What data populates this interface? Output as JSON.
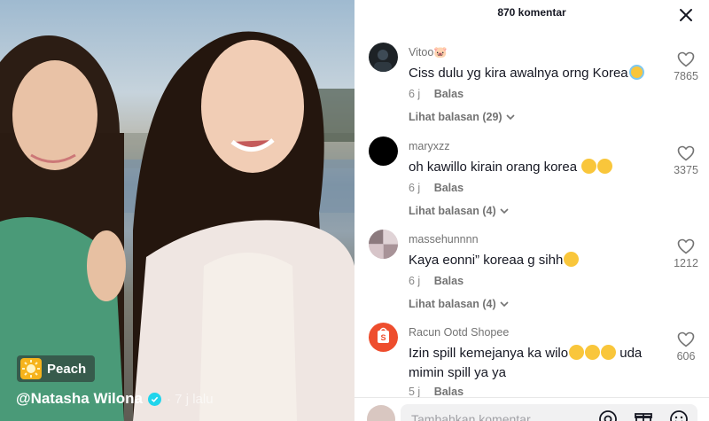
{
  "video": {
    "sticker_label": "Peach",
    "author": "@Natasha Wilona",
    "time": "· 7 j lalu"
  },
  "panel": {
    "title": "870 komentar"
  },
  "comments": [
    {
      "username": "Vitoo🐷",
      "text": "Ciss dulu yg kira awalnya orng Korea",
      "time": "6 j",
      "reply": "Balas",
      "view_replies": "Lihat balasan (29)",
      "likes": "7865"
    },
    {
      "username": "maryxzz",
      "text": "oh kawillo kirain orang korea",
      "time": "6 j",
      "reply": "Balas",
      "view_replies": "Lihat balasan (4)",
      "likes": "3375"
    },
    {
      "username": "massehunnnn",
      "text": "Kaya eonni” koreaa g sihh",
      "time": "6 j",
      "reply": "Balas",
      "view_replies": "Lihat balasan (4)",
      "likes": "1212"
    },
    {
      "username": "Racun Ootd Shopee",
      "text": "Izin spill kemejanya ka wilo",
      "text_end": "uda",
      "text_line2": "mimin spill ya ya",
      "time": "5 j",
      "reply": "Balas",
      "likes": "606"
    }
  ],
  "footer": {
    "placeholder": "Tambahkan komentar..."
  },
  "colors": {
    "accent_verified": "#20d5ec",
    "shopee": "#ee4d2d"
  },
  "icons": [
    "close-icon",
    "heart-icon",
    "chevron-down-icon",
    "verified-icon",
    "sun-icon",
    "at-icon",
    "gift-icon",
    "emoji-icon"
  ]
}
